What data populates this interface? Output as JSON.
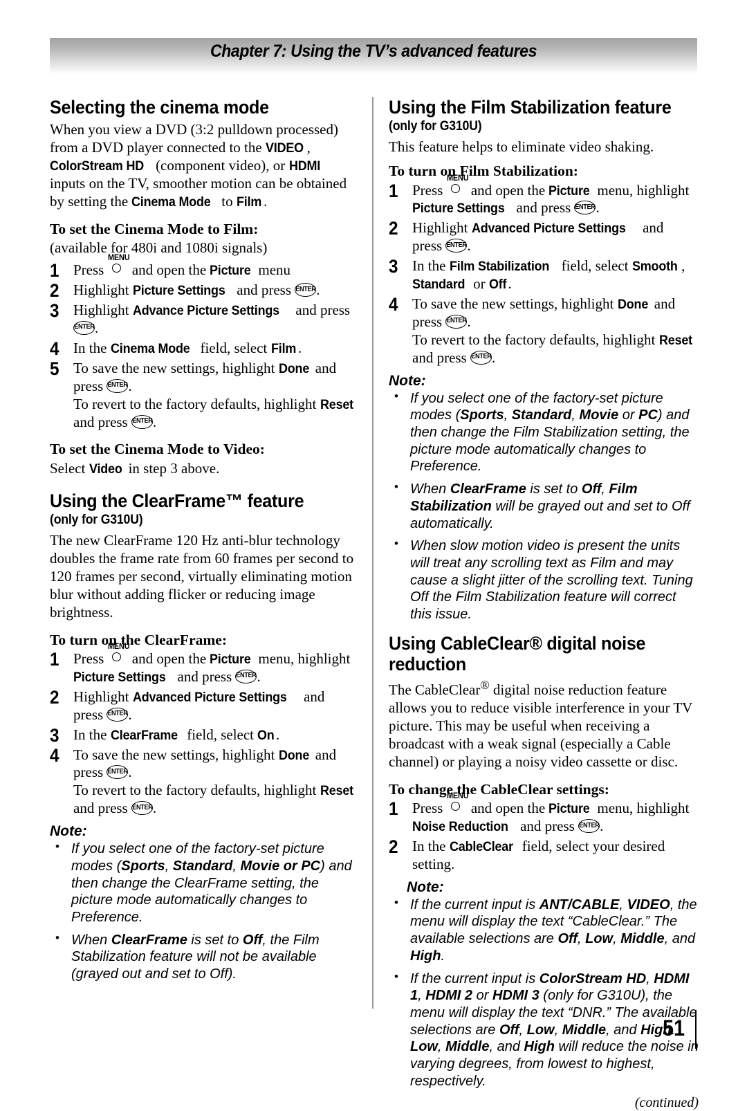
{
  "header": {
    "chapter_title": "Chapter 7: Using the TV’s advanced features"
  },
  "icons": {
    "menu_label": "MENU",
    "enter_label": "ENTER"
  },
  "footer": {
    "continued": "(continued)",
    "page_number": "51"
  },
  "left_column": {
    "section1": {
      "heading": "Selecting the cinema mode",
      "intro_1": "When you view a DVD (3:2 pulldown processed) from a DVD player connected to the ",
      "intro_term_video": "VIDEO",
      "intro_2": ", ",
      "intro_term_colorstream": "ColorStream HD",
      "intro_3": " (component video), or ",
      "intro_term_hdmi": "HDMI",
      "intro_4": " inputs on the TV, smoother motion can be obtained by setting the ",
      "intro_term_cinema": "Cinema Mode",
      "intro_5": " to ",
      "intro_term_film": "Film",
      "intro_6": ".",
      "sub1": "To set the Cinema Mode to Film:",
      "availability": "(available for 480i and 1080i signals)",
      "step1_a": "Press",
      "step1_b": "and open the ",
      "step1_term": "Picture",
      "step1_c": " menu",
      "step2_a": "Highlight ",
      "step2_term": "Picture Settings",
      "step2_b": " and press",
      "step2_c": ".",
      "step3_a": "Highlight ",
      "step3_term": "Advance Picture Settings",
      "step3_b": " and press",
      "step3_c": ".",
      "step4_a": "In the ",
      "step4_term": "Cinema Mode",
      "step4_b": " field, select ",
      "step4_term2": "Film",
      "step4_c": ".",
      "step5_a": "To save the new settings, highlight ",
      "step5_term": "Done",
      "step5_b": " and press",
      "step5_c": ".",
      "step5_d": "To revert to the factory defaults, highlight ",
      "step5_term2": "Reset",
      "step5_e": " and press",
      "step5_f": ".",
      "sub2": "To set the Cinema Mode to Video:",
      "video_line_a": "Select ",
      "video_term": "Video",
      "video_line_b": " in step 3 above."
    },
    "section2": {
      "heading": "Using the ClearFrame™ feature",
      "model_note": "(only for G310U)",
      "intro": "The new ClearFrame 120 Hz anti-blur technology doubles the frame rate from 60 frames per second to 120 frames per second, virtually eliminating motion blur without adding flicker or reducing image brightness.",
      "sub1": "To turn on the ClearFrame:",
      "step1_a": "Press",
      "step1_b": "and open the ",
      "step1_term": "Picture",
      "step1_c": " menu, highlight ",
      "step1_term2": "Picture Settings",
      "step1_d": " and press",
      "step1_e": ".",
      "step2_a": "Highlight ",
      "step2_term": "Advanced Picture Settings",
      "step2_b": " and press",
      "step2_c": ".",
      "step3_a": "In the ",
      "step3_term": "ClearFrame",
      "step3_b": " field, select ",
      "step3_term2": "On",
      "step3_c": ".",
      "step4_a": "To save the new settings, highlight ",
      "step4_term": "Done",
      "step4_b": " and press",
      "step4_c": ".",
      "step4_d": "To revert to the factory defaults, highlight ",
      "step4_term2": "Reset",
      "step4_e": " and press",
      "step4_f": ".",
      "note_head": "Note:",
      "note1_a": "If you select one of the factory-set picture modes (",
      "note1_b1": "Sports",
      "note1_c1": ", ",
      "note1_b2": "Standard",
      "note1_c2": ", ",
      "note1_b3": "Movie or PC",
      "note1_d": ") and then change the ClearFrame setting, the picture mode automatically changes to Preference.",
      "note2_a": "When ",
      "note2_b1": "ClearFrame",
      "note2_c": " is set to ",
      "note2_b2": "Off",
      "note2_d": ", the Film Stabilization feature will not be available (grayed out and set to Off)."
    }
  },
  "right_column": {
    "section1": {
      "heading": "Using the Film Stabilization feature",
      "model_note": "(only for G310U)",
      "intro": "This feature helps to eliminate video shaking.",
      "sub1": "To turn on Film Stabilization:",
      "step1_a": "Press",
      "step1_b": "and open the ",
      "step1_term": "Picture",
      "step1_c": " menu, highlight ",
      "step1_term2": "Picture Settings",
      "step1_d": " and press",
      "step1_e": ".",
      "step2_a": "Highlight ",
      "step2_term": "Advanced Picture Settings",
      "step2_b": " and press",
      "step2_c": ".",
      "step3_a": "In the ",
      "step3_term": "Film Stabilization",
      "step3_b": " field, select ",
      "step3_term2": "Smooth",
      "step3_c": ", ",
      "step3_term3": "Standard",
      "step3_d": " or ",
      "step3_term4": "Off",
      "step3_e": ".",
      "step4_a": "To save the new settings, highlight ",
      "step4_term": "Done",
      "step4_b": " and press",
      "step4_c": ".",
      "step4_d": "To revert to the factory defaults, highlight ",
      "step4_term2": "Reset",
      "step4_e": " and press",
      "step4_f": ".",
      "note_head": "Note:",
      "note1_a": "If you select one of the factory-set picture modes (",
      "note1_b1": "Sports",
      "note1_c1": ", ",
      "note1_b2": "Standard",
      "note1_c2": ", ",
      "note1_b3": "Movie",
      "note1_c3": " or ",
      "note1_b4": "PC",
      "note1_d": ") and then change the Film Stabilization setting, the picture mode automatically changes to Preference.",
      "note2_a": "When ",
      "note2_b1": "ClearFrame",
      "note2_c": " is set to ",
      "note2_b2": "Off",
      "note2_d": ", ",
      "note2_b3": "Film Stabilization",
      "note2_e": " will be grayed out and set to Off automatically.",
      "note3": "When slow motion video is present the units will treat any scrolling text as Film and may cause a slight jitter of the scrolling text. Tuning Off the Film Stabilization feature will correct this issue."
    },
    "section2": {
      "heading": "Using CableClear® digital noise reduction",
      "intro_a": "The CableClear",
      "intro_reg": "®",
      "intro_b": " digital noise reduction feature allows you to reduce visible interference in your TV picture. This may be useful when receiving a broadcast with a weak signal (especially a Cable channel) or playing a noisy video cassette or disc.",
      "sub1": "To change the CableClear settings:",
      "step1_a": "Press",
      "step1_b": "and open the ",
      "step1_term": "Picture",
      "step1_c": " menu, highlight ",
      "step1_term2": "Noise Reduction",
      "step1_d": " and press",
      "step1_e": ".",
      "step2_a": "In the ",
      "step2_term": "CableClear",
      "step2_b": " field, select your desired setting.",
      "note_head": "Note:",
      "note1_a": "If the current input is ",
      "note1_b1": "ANT/CABLE",
      "note1_c1": ", ",
      "note1_b2": "VIDEO",
      "note1_c2": ", the menu will display the text “CableClear.” The available selections are ",
      "note1_b3": "Off",
      "note1_c3": ", ",
      "note1_b4": "Low",
      "note1_c4": ", ",
      "note1_b5": "Middle",
      "note1_c5": ", and ",
      "note1_b6": "High",
      "note1_c6": ".",
      "note2_a": "If the current input is ",
      "note2_b1": "ColorStream HD",
      "note2_c1": ", ",
      "note2_b2": "HDMI 1",
      "note2_c2": ", ",
      "note2_b3": "HDMI 2",
      "note2_c3": " or ",
      "note2_b4": "HDMI 3",
      "note2_c4": " (only for G310U)",
      "note2_c5": ", the menu will display the text “DNR.” The available selections are ",
      "note2_b5": "Off",
      "note2_c6": ", ",
      "note2_b6": "Low",
      "note2_c7": ", ",
      "note2_b7": "Middle",
      "note2_c8": ", and ",
      "note2_b8": "High",
      "note2_c9": ". ",
      "note2_b9": "Low",
      "note2_c10": ", ",
      "note2_b10": "Middle",
      "note2_c11": ", and ",
      "note2_b11": "High",
      "note2_c12": " will reduce the noise in varying degrees, from lowest to highest, respectively."
    }
  }
}
